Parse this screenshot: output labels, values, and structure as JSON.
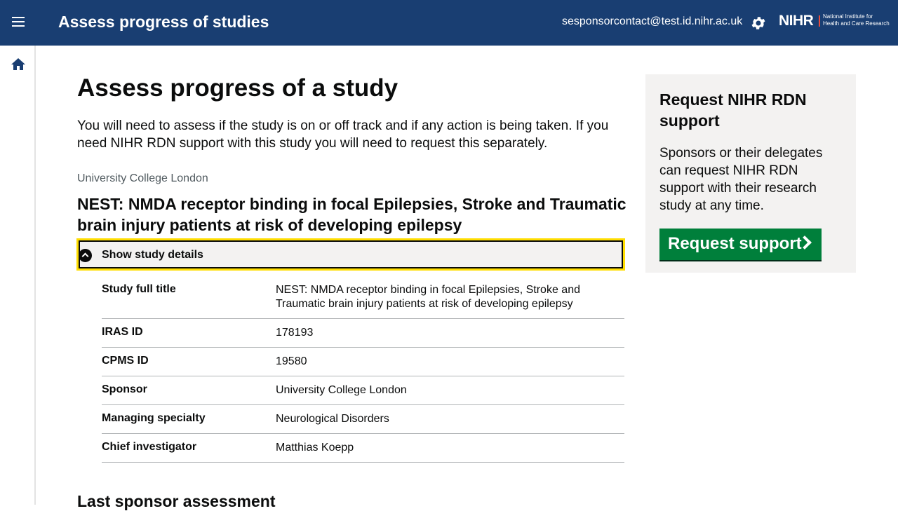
{
  "header": {
    "title": "Assess progress of studies",
    "user_email": "sesponsorcontact@test.id.nihr.ac.uk",
    "logo_main": "NIHR",
    "logo_sub_line1": "National Institute for",
    "logo_sub_line2": "Health and Care Research"
  },
  "page": {
    "heading": "Assess progress of a study",
    "intro": "You will need to assess if the study is on or off track and if any action is being taken. If you need NIHR RDN support with this study you will need to request this separately.",
    "organisation": "University College London",
    "study_title": "NEST: NMDA receptor binding in focal Epilepsies, Stroke and Traumatic brain injury patients at risk of developing epilepsy",
    "details_toggle": "Show study details",
    "next_heading": "Last sponsor assessment"
  },
  "study_details": [
    {
      "key": "Study full title",
      "value": "NEST: NMDA receptor binding in focal Epilepsies, Stroke and Traumatic brain injury patients at risk of developing epilepsy"
    },
    {
      "key": "IRAS ID",
      "value": "178193"
    },
    {
      "key": "CPMS ID",
      "value": "19580"
    },
    {
      "key": "Sponsor",
      "value": "University College London"
    },
    {
      "key": "Managing specialty",
      "value": "Neurological Disorders"
    },
    {
      "key": "Chief investigator",
      "value": "Matthias Koepp"
    }
  ],
  "aside": {
    "title": "Request NIHR RDN support",
    "text": "Sponsors or their delegates can request NIHR RDN support with their research study at any time.",
    "button": "Request support"
  },
  "colors": {
    "header_bg": "#193e72",
    "button_green": "#007f3b",
    "focus_yellow": "#ffdd00"
  }
}
